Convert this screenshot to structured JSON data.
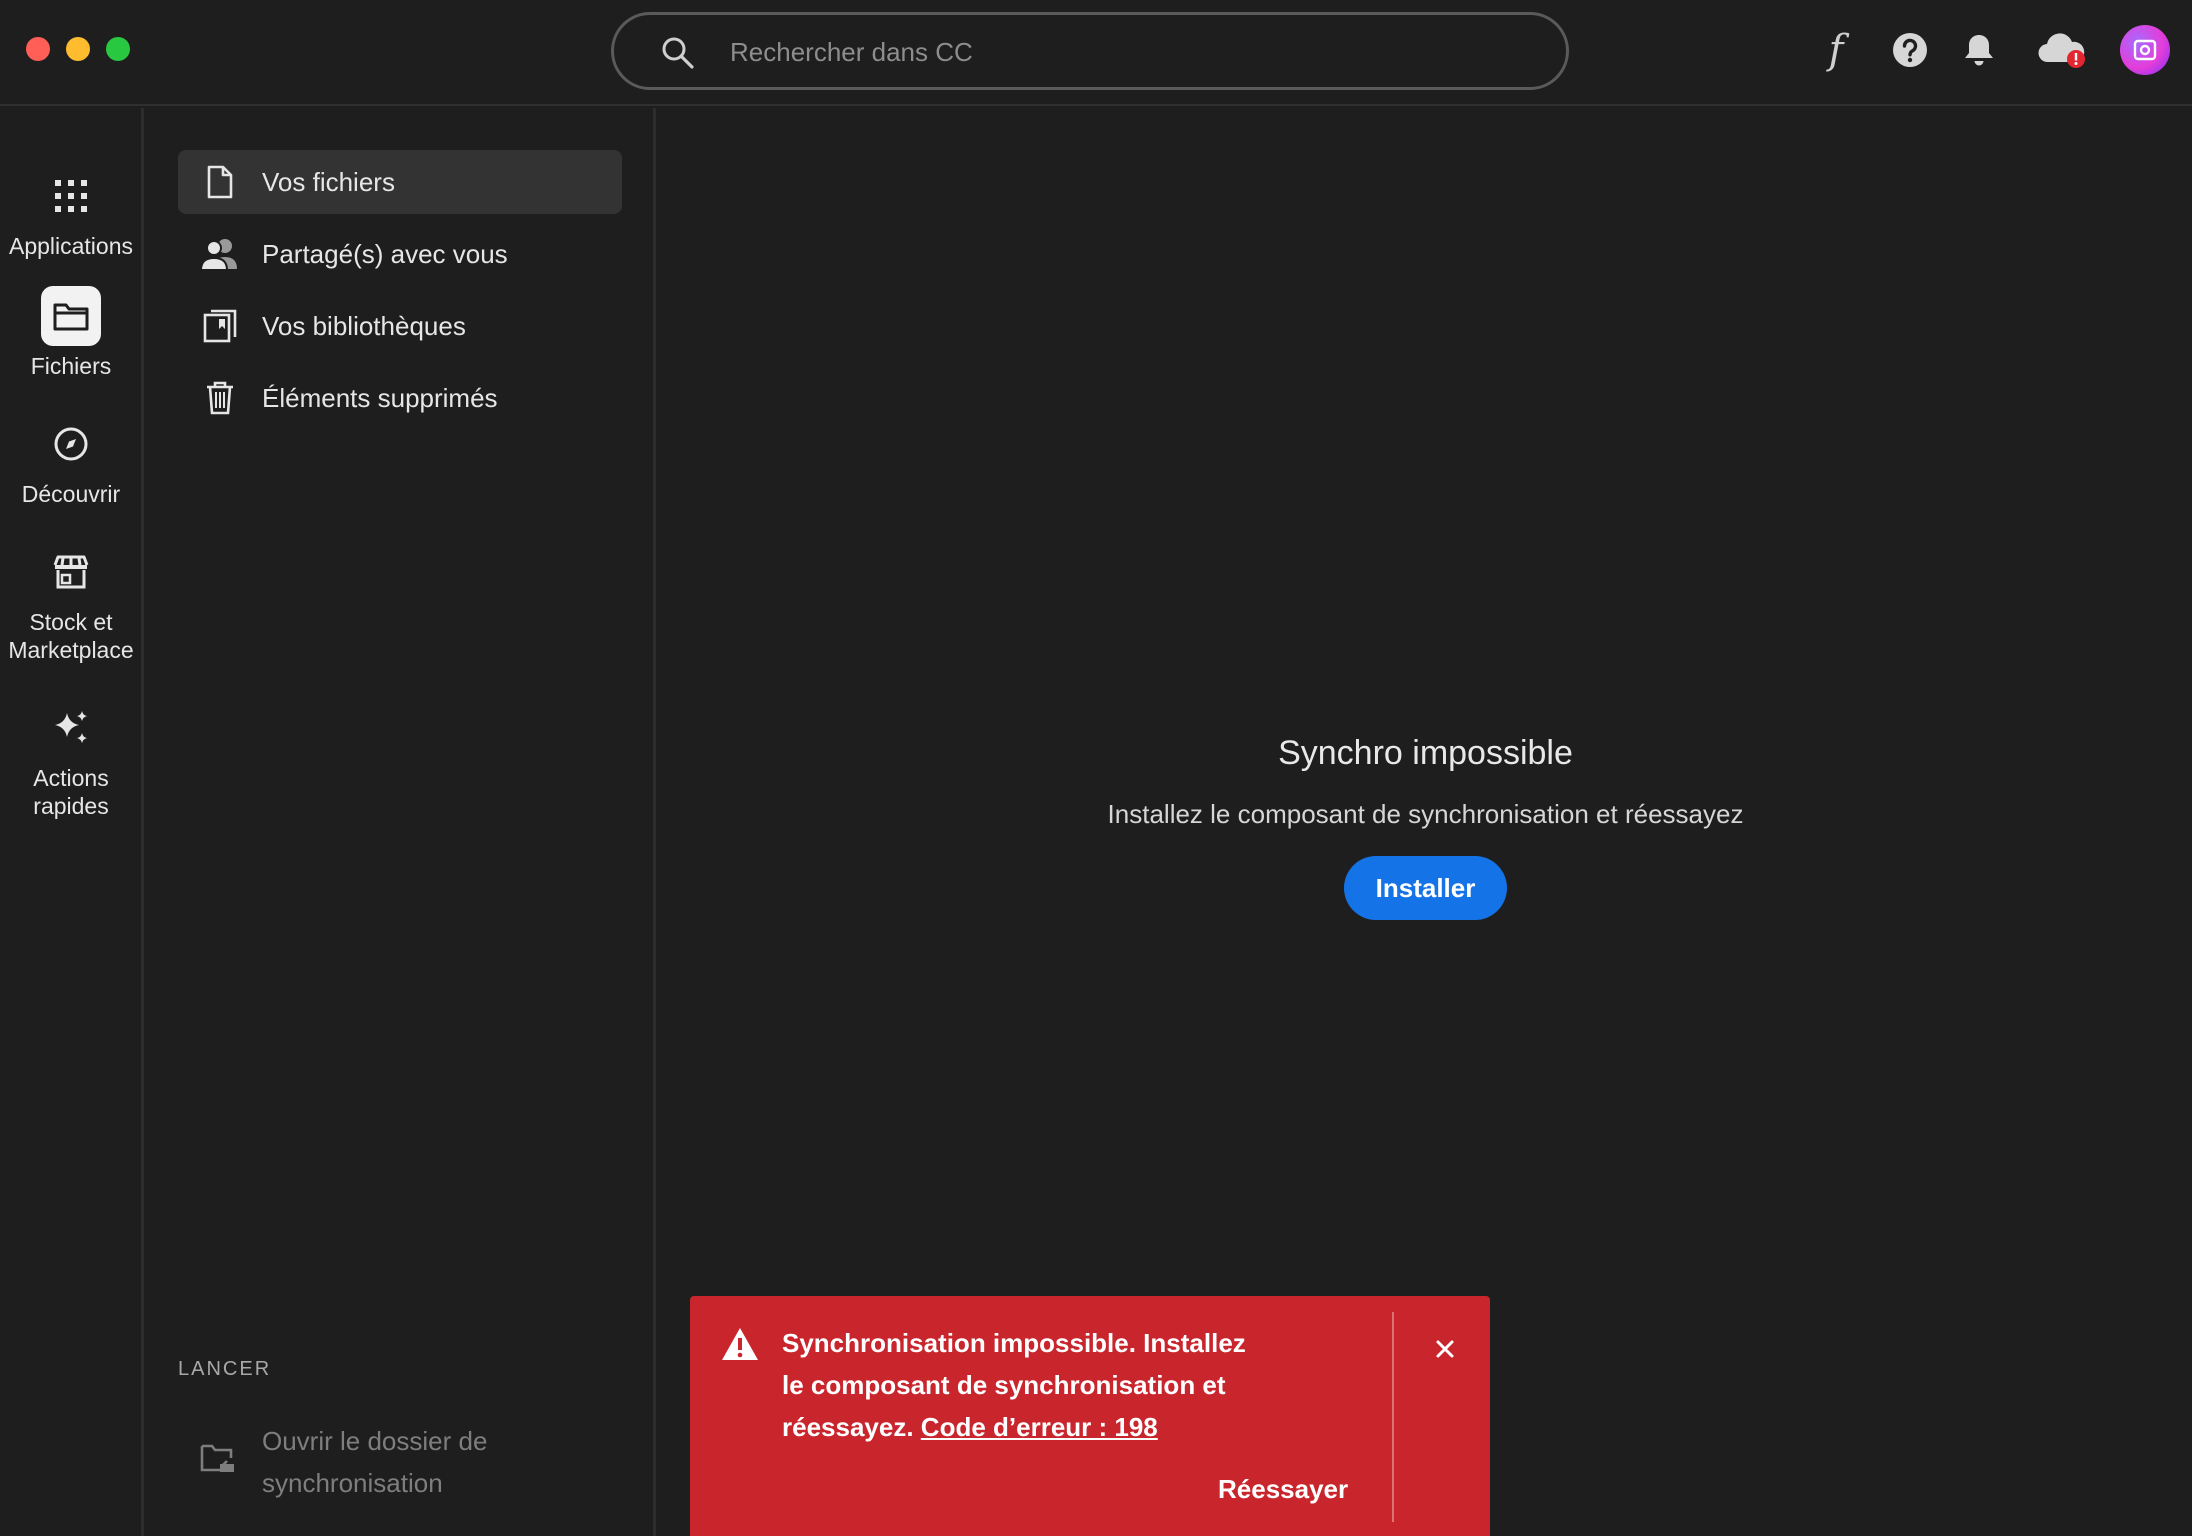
{
  "window": {
    "controls": [
      "close",
      "minimize",
      "zoom"
    ]
  },
  "search": {
    "placeholder": "Rechercher dans CC",
    "value": ""
  },
  "toolbar": {
    "font_label": "f",
    "icons": [
      "font-icon",
      "help-icon",
      "bell-icon",
      "cloud-sync-error-icon",
      "avatar"
    ]
  },
  "rail": {
    "items": [
      {
        "label": "Applications",
        "icon": "apps-grid-icon",
        "active": false
      },
      {
        "label": "Fichiers",
        "icon": "folder-icon",
        "active": true
      },
      {
        "label": "Découvrir",
        "icon": "compass-icon",
        "active": false
      },
      {
        "label": "Stock et Marketplace",
        "icon": "storefront-icon",
        "active": false
      },
      {
        "label": "Actions rapides",
        "icon": "sparkle-icon",
        "active": false
      }
    ]
  },
  "nav": {
    "items": [
      {
        "label": "Vos fichiers",
        "icon": "file-icon",
        "active": true
      },
      {
        "label": "Partagé(s) avec vous",
        "icon": "people-icon",
        "active": false
      },
      {
        "label": "Vos bibliothèques",
        "icon": "library-icon",
        "active": false
      },
      {
        "label": "Éléments supprimés",
        "icon": "trash-icon",
        "active": false
      }
    ],
    "launch_heading": "LANCER",
    "launch_item": {
      "label": "Ouvrir le dossier de synchronisation",
      "icon": "folder-open-icon",
      "disabled": true
    }
  },
  "main": {
    "title": "Synchro impossible",
    "message": "Installez le composant de synchronisation et réessayez",
    "install_label": "Installer"
  },
  "toast": {
    "message": "Synchronisation impossible. Installez le composant de synchronisation et réessayez.",
    "link": "Code d’erreur : 198",
    "retry_label": "Réessayer",
    "icon": "warning-icon"
  },
  "colors": {
    "background": "#1e1e1e",
    "accent": "#1473e6",
    "error": "#c9252d",
    "selected": "#333333"
  }
}
